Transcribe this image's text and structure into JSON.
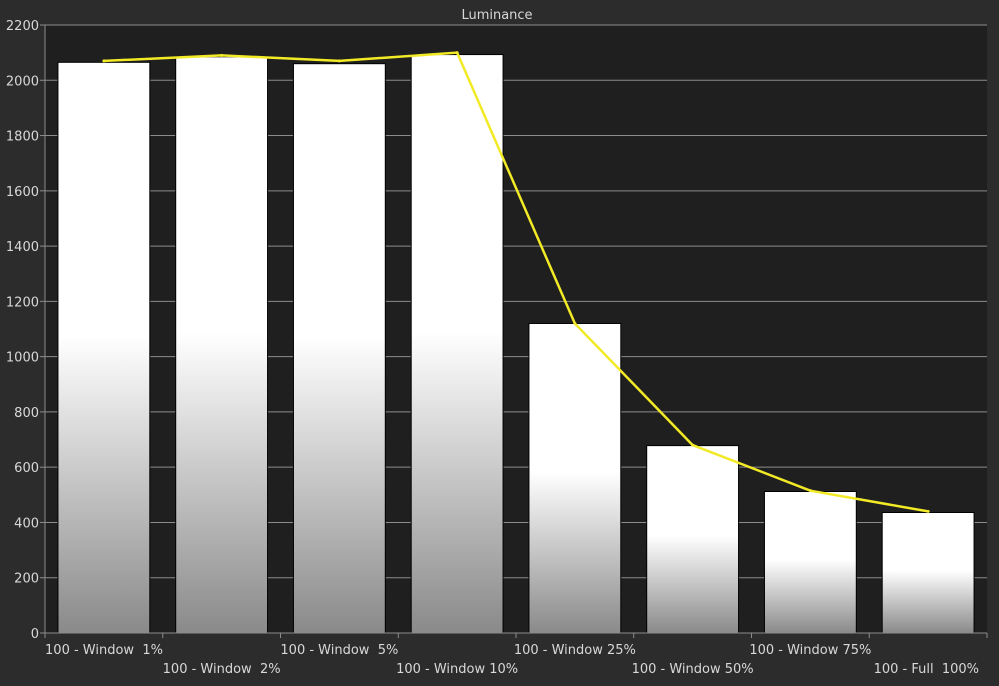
{
  "chart_data": {
    "type": "bar",
    "title": "Luminance",
    "xlabel": "",
    "ylabel": "",
    "ylim": [
      0,
      2200
    ],
    "yticks": [
      0,
      200,
      400,
      600,
      800,
      1000,
      1200,
      1400,
      1600,
      1800,
      2000,
      2200
    ],
    "categories": [
      "100 - Window  1%",
      "100 - Window  2%",
      "100 - Window  5%",
      "100 - Window 10%",
      "100 - Window 25%",
      "100 - Window 50%",
      "100 - Window 75%",
      "100 - Full  100%"
    ],
    "series": [
      {
        "kind": "bar",
        "values": [
          2065,
          2085,
          2060,
          2093,
          1120,
          678,
          512,
          436
        ]
      },
      {
        "kind": "line",
        "color": "#f2ea26",
        "values": [
          2070,
          2090,
          2070,
          2100,
          1120,
          680,
          515,
          440
        ]
      }
    ],
    "grid": true,
    "legend": "none"
  },
  "colors": {
    "background": "#2c2c2c",
    "plot_background": "#1f1f1f",
    "bar_top": "#ffffff",
    "bar_bottom": "#8a8a8a",
    "line": "#f2ea26",
    "grid": "#8c8c8c",
    "text": "#d8d8d8"
  }
}
